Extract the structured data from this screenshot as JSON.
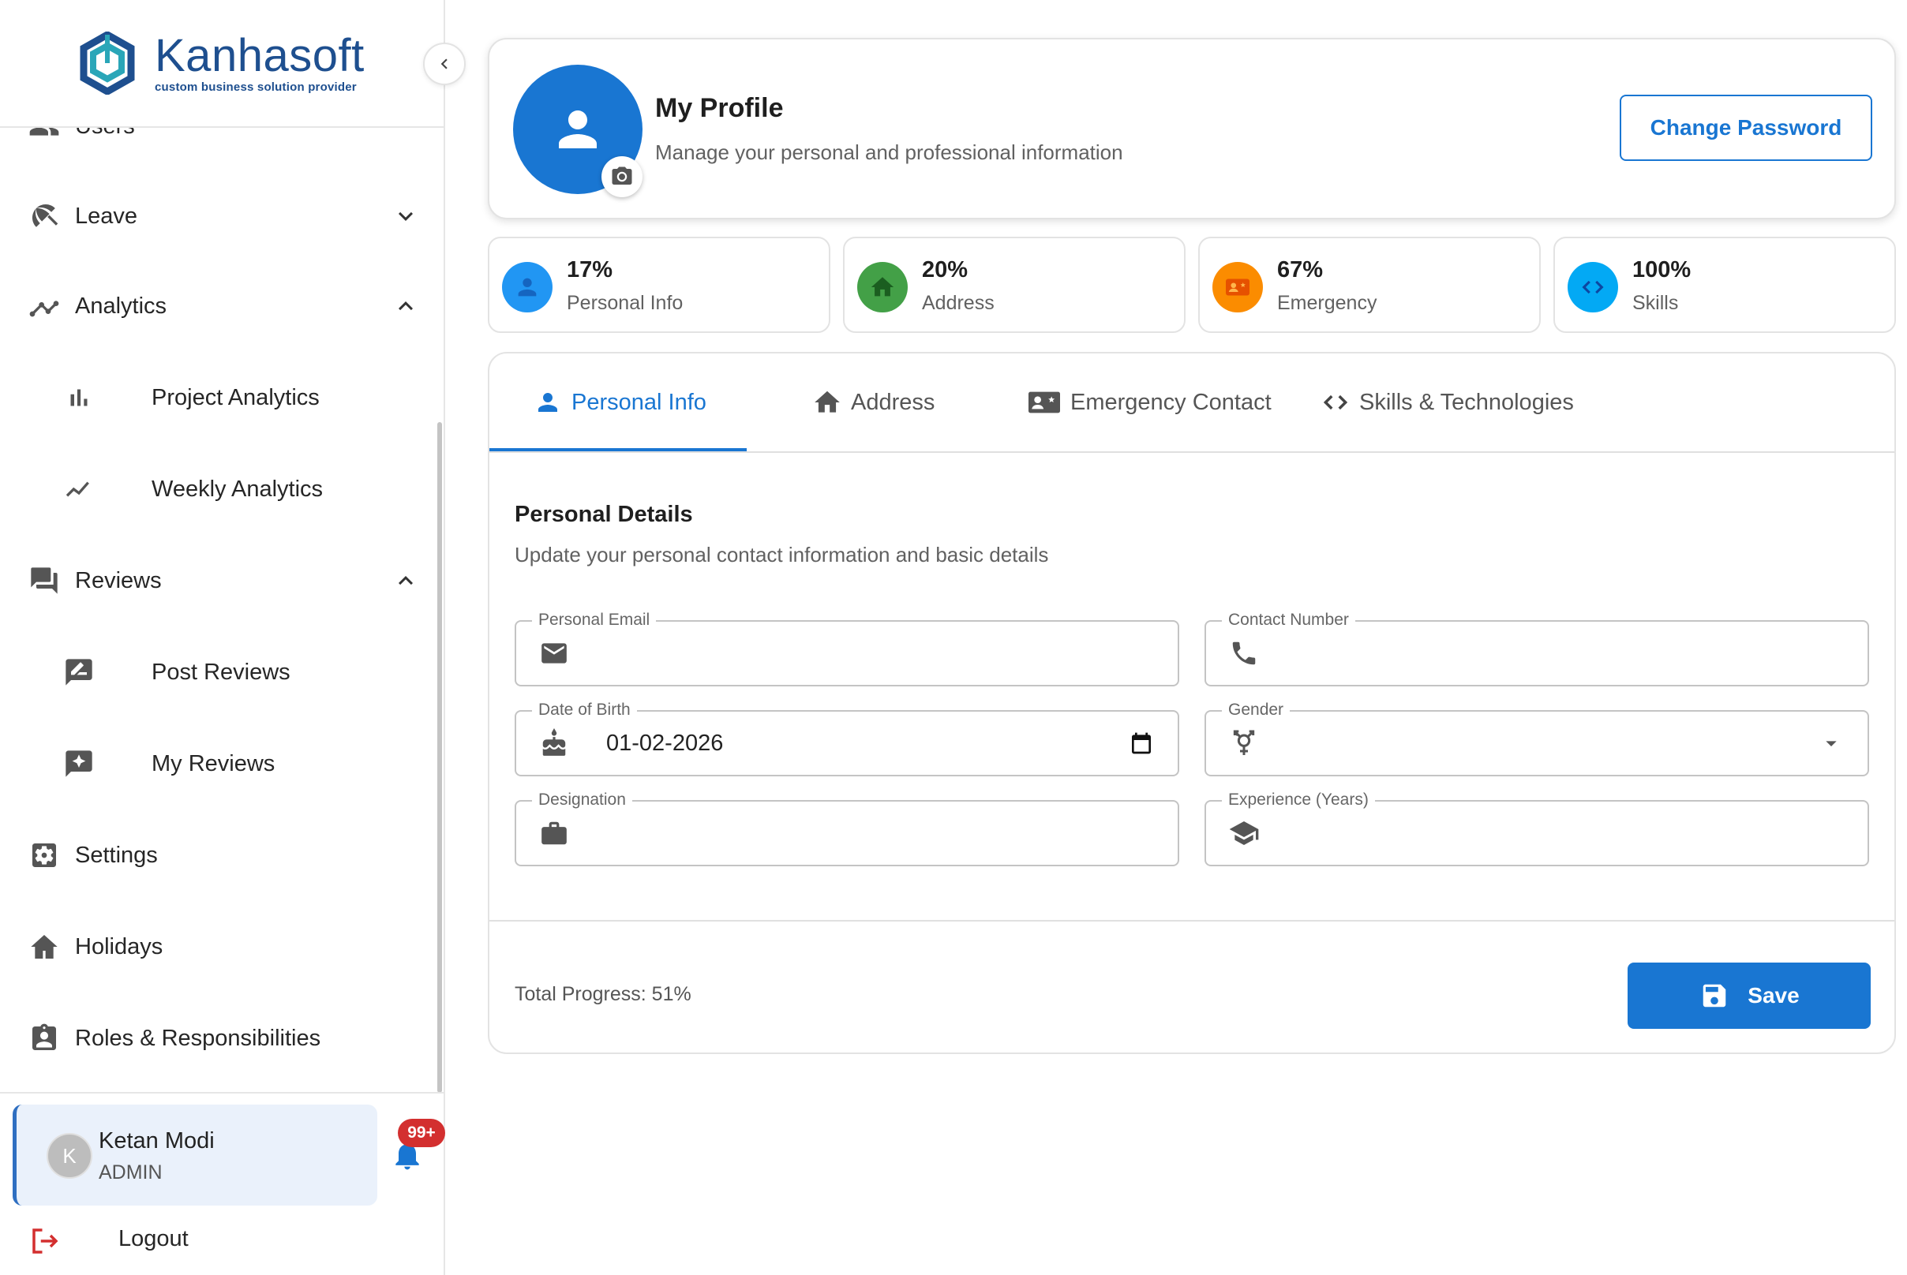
{
  "brand": {
    "name": "Kanhasoft",
    "tagline": "custom business solution provider",
    "colors": {
      "primary": "#1976d2",
      "logo_navy": "#1e4f8f",
      "logo_teal": "#2aa6b8"
    }
  },
  "sidebar": {
    "partial_top_item": {
      "label": "Users",
      "icon": "users-icon"
    },
    "items": [
      {
        "label": "Leave",
        "icon": "umbrella-icon",
        "chevron": "chevron-down-icon"
      },
      {
        "label": "Analytics",
        "icon": "analytics-icon",
        "chevron": "chevron-up-icon"
      },
      {
        "label": "Project Analytics",
        "icon": "bar-chart-icon",
        "sub": true
      },
      {
        "label": "Weekly Analytics",
        "icon": "trend-line-icon",
        "sub": true
      },
      {
        "label": "Reviews",
        "icon": "reviews-icon",
        "chevron": "chevron-up-icon"
      },
      {
        "label": "Post Reviews",
        "icon": "rate-review-icon",
        "sub": true
      },
      {
        "label": "My Reviews",
        "icon": "star-review-icon",
        "sub": true
      },
      {
        "label": "Settings",
        "icon": "settings-icon"
      },
      {
        "label": "Holidays",
        "icon": "home-icon"
      },
      {
        "label": "Roles & Responsibilities",
        "icon": "badge-icon"
      }
    ],
    "user": {
      "initial": "K",
      "name": "Ketan Modi",
      "role": "ADMIN"
    },
    "notifications": {
      "badge": "99+",
      "icon": "bell-icon"
    },
    "logout": {
      "label": "Logout",
      "icon": "logout-icon"
    }
  },
  "profile": {
    "title": "My Profile",
    "subtitle": "Manage your personal and professional information",
    "change_password": "Change Password"
  },
  "stats": [
    {
      "percent": "17%",
      "label": "Personal Info",
      "color": "#2196f3",
      "icon": "person-icon"
    },
    {
      "percent": "20%",
      "label": "Address",
      "color": "#43a047",
      "icon": "home-icon"
    },
    {
      "percent": "67%",
      "label": "Emergency",
      "color": "#fb8c00",
      "icon": "contact-card-icon"
    },
    {
      "percent": "100%",
      "label": "Skills",
      "color": "#03a9f4",
      "icon": "code-icon"
    }
  ],
  "tabs": [
    {
      "label": "Personal Info",
      "icon": "person-icon",
      "active": true
    },
    {
      "label": "Address",
      "icon": "home-icon"
    },
    {
      "label": "Emergency Contact",
      "icon": "contact-emergency-icon"
    },
    {
      "label": "Skills & Technologies",
      "icon": "code-icon"
    }
  ],
  "form": {
    "title": "Personal Details",
    "subtitle": "Update your personal contact information and basic details",
    "fields": [
      {
        "label": "Personal Email",
        "icon": "email-icon",
        "value": ""
      },
      {
        "label": "Contact Number",
        "icon": "phone-icon",
        "value": ""
      },
      {
        "label": "Date of Birth",
        "icon": "cake-icon",
        "value": "01-02-2026",
        "end_icon": "calendar-icon"
      },
      {
        "label": "Gender",
        "icon": "gender-icon",
        "value": "",
        "end_icon": "dropdown-arrow-icon"
      },
      {
        "label": "Designation",
        "icon": "briefcase-icon",
        "value": ""
      },
      {
        "label": "Experience (Years)",
        "icon": "school-icon",
        "value": ""
      }
    ]
  },
  "footer": {
    "total_progress": "Total Progress: 51%",
    "save_label": "Save",
    "save_icon": "save-icon"
  }
}
